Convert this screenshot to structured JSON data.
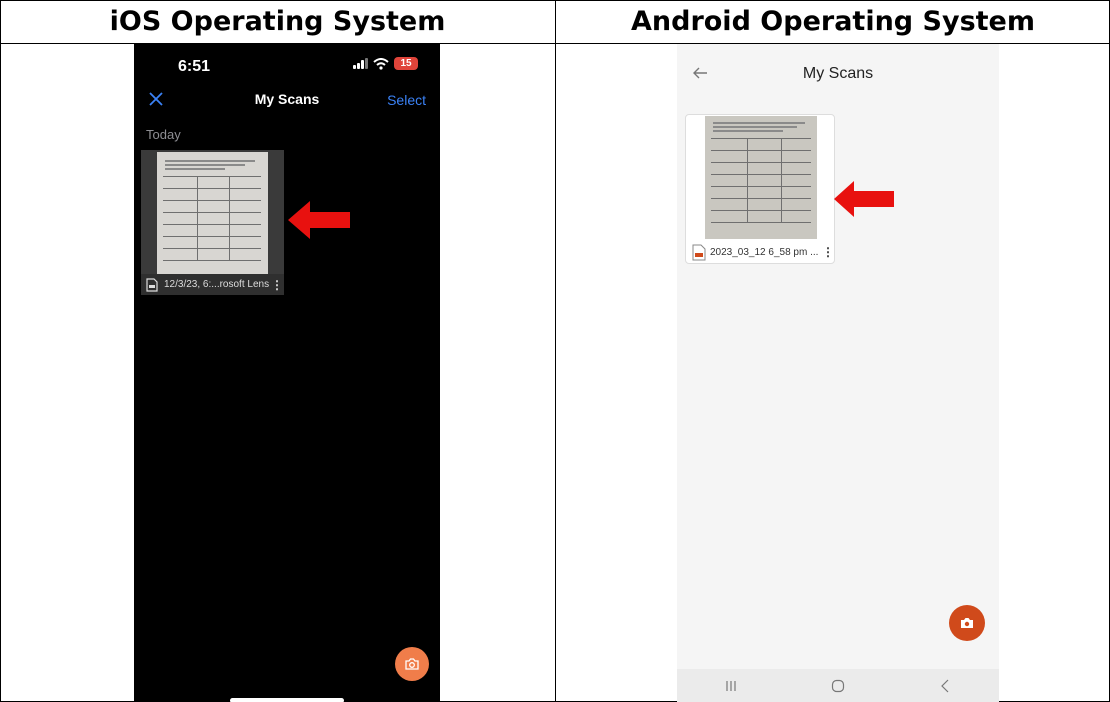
{
  "table": {
    "left_header": "iOS Operating System",
    "right_header": "Android Operating System"
  },
  "ios": {
    "status": {
      "time": "6:51",
      "battery": "15"
    },
    "nav": {
      "title": "My Scans",
      "select_label": "Select"
    },
    "section_label": "Today",
    "scans": [
      {
        "name": "12/3/23, 6:...rosoft Lens"
      }
    ],
    "colors": {
      "background": "#000000",
      "accent": "#3b82f6",
      "fab": "#f07d4a",
      "battery": "#e0443a"
    }
  },
  "android": {
    "nav": {
      "title": "My Scans"
    },
    "scans": [
      {
        "name": "2023_03_12 6_58 pm ..."
      }
    ],
    "system_nav": [
      "recents",
      "home",
      "back"
    ],
    "colors": {
      "background": "#f5f5f5",
      "fab": "#d04a1b"
    }
  },
  "annotations": {
    "arrow_color": "#e8110f"
  }
}
